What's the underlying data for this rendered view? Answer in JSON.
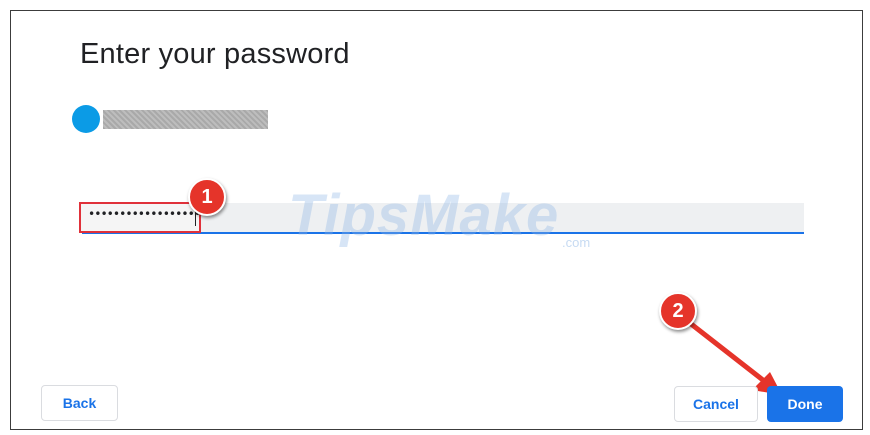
{
  "dialog": {
    "title": "Enter your password",
    "password_masked": "••••••••••••••••••••",
    "back_label": "Back",
    "cancel_label": "Cancel",
    "done_label": "Done"
  },
  "annotations": {
    "step1": "1",
    "step2": "2",
    "color": "#e5342a"
  },
  "watermark": {
    "text": "TipsMake",
    "tld": ".com"
  },
  "colors": {
    "accent": "#1a73e8",
    "avatar": "#0b9be6",
    "highlight": "#e0313a"
  }
}
